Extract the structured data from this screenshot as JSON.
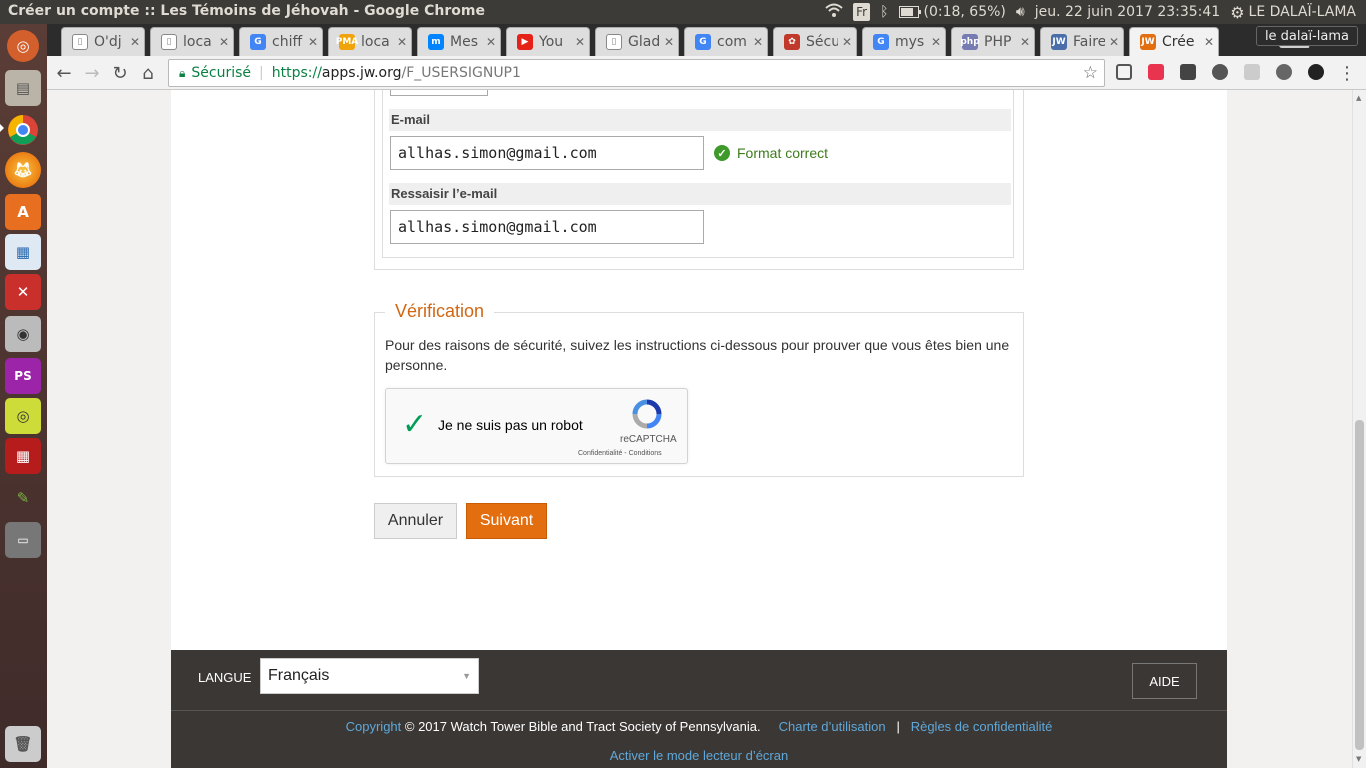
{
  "system": {
    "window_title": "Créer un compte :: Les Témoins de Jéhovah - Google Chrome",
    "keyboard_layout": "Fr",
    "battery": "(0:18, 65%)",
    "datetime": "jeu. 22 juin 2017 23:35:41",
    "user": "LE DALAÏ-LAMA"
  },
  "launcher": {
    "icons": [
      "ubuntu-dash-icon",
      "files-icon",
      "chrome-icon",
      "firefox-icon",
      "software-center-icon",
      "document-viewer-icon",
      "system-settings-icon",
      "screenshot-icon",
      "phpstorm-icon",
      "webcam-icon",
      "workspaces-icon",
      "color-picker-icon",
      "window-icon",
      "trash-icon"
    ]
  },
  "browser": {
    "profile": "le dalaï-lama",
    "tabs": [
      {
        "label": "O'dj",
        "fav_color": "#888888",
        "fav": "doc"
      },
      {
        "label": "loca",
        "fav_color": "#888888",
        "fav": "doc"
      },
      {
        "label": "chiff",
        "fav_color": "#4285f4",
        "fav": "G"
      },
      {
        "label": "loca",
        "fav_color": "#f0a30a",
        "fav": "PMA"
      },
      {
        "label": "Mes",
        "fav_color": "#0084ff",
        "fav": "m"
      },
      {
        "label": "You",
        "fav_color": "#e62117",
        "fav": "▶"
      },
      {
        "label": "Glad",
        "fav_color": "#888888",
        "fav": "doc"
      },
      {
        "label": "com",
        "fav_color": "#4285f4",
        "fav": "G"
      },
      {
        "label": "Sécu",
        "fav_color": "#c0392b",
        "fav": "✿"
      },
      {
        "label": "mys",
        "fav_color": "#4285f4",
        "fav": "G"
      },
      {
        "label": "PHP",
        "fav_color": "#777bb3",
        "fav": "php"
      },
      {
        "label": "Faire",
        "fav_color": "#4a6ea9",
        "fav": "JW"
      },
      {
        "label": "Crée",
        "fav_color": "#e36e0f",
        "fav": "JW",
        "active": true
      }
    ],
    "secure_label": "Sécurisé",
    "url_scheme": "https://",
    "url_host": "apps.jw.org",
    "url_path": "/F_USERSIGNUP1"
  },
  "form": {
    "email_label": "E-mail",
    "email_value": "allhas.simon@gmail.com",
    "email_status": "Format correct",
    "email_confirm_label": "Ressaisir l’e-mail",
    "email_confirm_value": "allhas.simon@gmail.com"
  },
  "verification": {
    "legend": "Vérification",
    "instructions": "Pour des raisons de sécurité, suivez les instructions ci-dessous pour prouver que vous êtes bien une personne.",
    "captcha_label": "Je ne suis pas un robot",
    "captcha_brand": "reCAPTCHA",
    "captcha_terms": "Confidentialité - Conditions",
    "captcha_checked": true
  },
  "actions": {
    "cancel_label": "Annuler",
    "next_label": "Suivant"
  },
  "footer": {
    "language_label": "LANGUE",
    "language_value": "Français",
    "help_label": "AIDE",
    "copyright_link": "Copyright",
    "copyright_text": "© 2017 Watch Tower Bible and Tract Society of Pennsylvania.",
    "terms_link": "Charte d’utilisation",
    "separator": "|",
    "privacy_link": "Règles de confidentialité",
    "reader_mode_link": "Activer le mode lecteur d’écran"
  },
  "colors": {
    "accent_orange": "#e36e0f",
    "valid_green": "#3d7b1b",
    "link_blue": "#5fa8d9",
    "footer_bg": "#3b3735"
  }
}
